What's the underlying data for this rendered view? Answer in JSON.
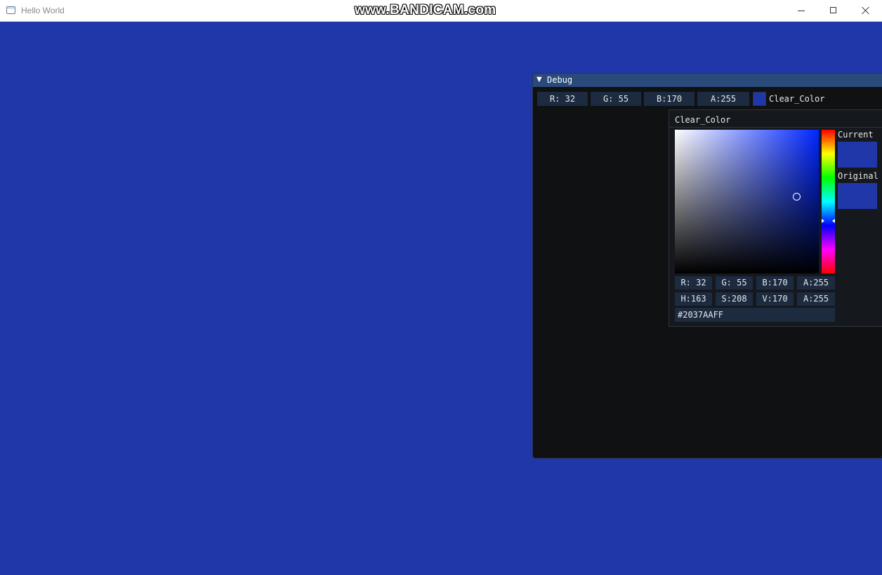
{
  "app": {
    "title": "Hello World",
    "watermark": "www.BANDICAM.com",
    "clear_color_hex": "#2037AA"
  },
  "debug_window": {
    "title": "Debug",
    "collapse_glyph": "▼",
    "rgba": [
      "R: 32",
      "G: 55",
      "B:170",
      "A:255"
    ],
    "color_label": "Clear_Color"
  },
  "picker": {
    "title": "Clear_Color",
    "current_label": "Current",
    "original_label": "Original",
    "rgba": [
      "R: 32",
      "G: 55",
      "B:170",
      "A:255"
    ],
    "hsva": [
      "H:163",
      "S:208",
      "V:170",
      "A:255"
    ],
    "hex": "#2037AAFF"
  },
  "colors": {
    "background": "#2037AA",
    "imgui_title": "#294a7a",
    "imgui_frame": "#1d2b40",
    "imgui_bg": "#0f1113"
  },
  "icons": [
    "app-window-icon",
    "minimize-icon",
    "maximize-icon",
    "close-icon",
    "collapse-arrow-icon"
  ]
}
